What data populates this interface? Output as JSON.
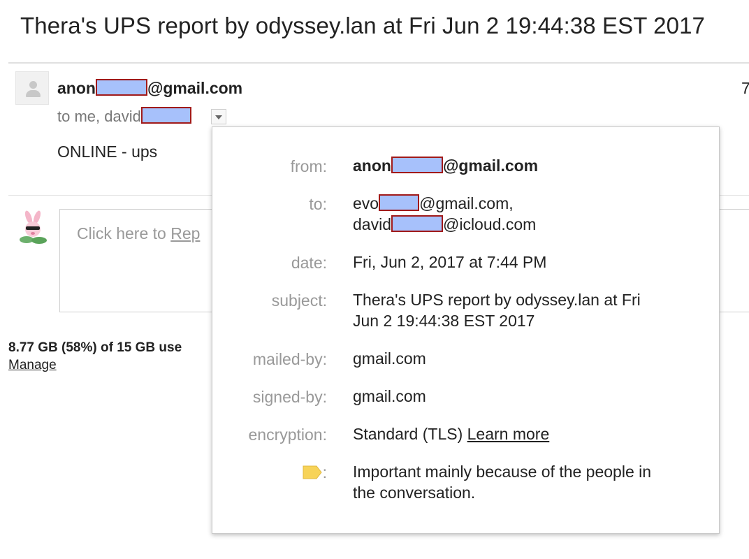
{
  "email": {
    "subject": "Thera's UPS report by odyssey.lan at Fri Jun 2 19:44:38 EST 2017",
    "sender_prefix": "anon",
    "sender_suffix": "@gmail.com",
    "to_prefix": "to me, david",
    "time_partial": "7",
    "snippet": "ONLINE - ups"
  },
  "details": {
    "from_label": "from:",
    "from_prefix": "anon",
    "from_suffix": "@gmail.com",
    "to_label": "to:",
    "to_1_prefix": "evo",
    "to_1_suffix": "@gmail.com,",
    "to_2_prefix": "david",
    "to_2_suffix": "@icloud.com",
    "date_label": "date:",
    "date_value": "Fri, Jun 2, 2017 at 7:44 PM",
    "subject_label": "subject:",
    "subject_line1": "Thera's UPS report by odyssey.lan at Fri",
    "subject_line2": "Jun 2 19:44:38 EST 2017",
    "mailed_by_label": "mailed-by:",
    "mailed_by_value": "gmail.com",
    "signed_by_label": "signed-by:",
    "signed_by_value": "gmail.com",
    "encryption_label": "encryption:",
    "encryption_value": "Standard (TLS)",
    "learn_more": "Learn more",
    "importance_colon": ":",
    "importance_line1": "Important mainly because of the people in",
    "importance_line2": "the conversation."
  },
  "reply": {
    "prompt": "Click here to ",
    "link_text": "Rep"
  },
  "storage": {
    "usage": "8.77 GB (58%) of 15 GB use",
    "manage": "Manage"
  },
  "colors": {
    "redaction_fill": "#a7c1fb",
    "redaction_border": "#a11a1a",
    "importance_marker": "#f7d358"
  },
  "icons": {
    "sender_avatar": "default-person-avatar",
    "reply_avatar": "bunny-avatar",
    "dropdown": "chevron-down-icon",
    "importance": "importance-marker-icon"
  }
}
